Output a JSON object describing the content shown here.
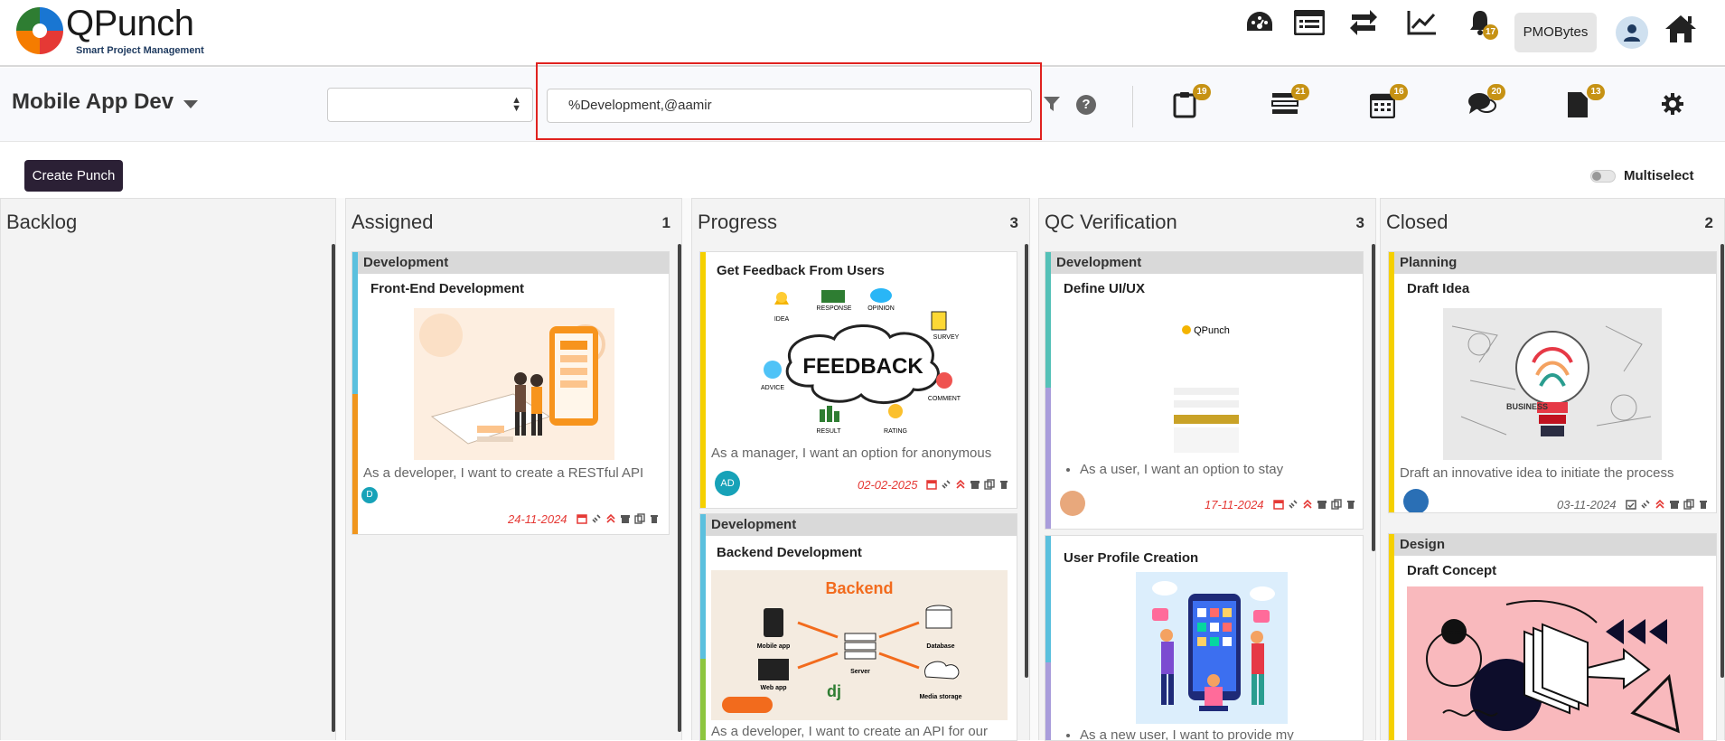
{
  "nav": {
    "brand": "QPunch",
    "tagline": "Smart Project Management",
    "notification_count": "17",
    "user_org": "PMOBytes",
    "icons": [
      "dashboard-icon",
      "list-icon",
      "sync-icon",
      "chart-line-icon",
      "bell-icon",
      "profile-avatar-icon",
      "home-icon"
    ]
  },
  "project": {
    "title": "Mobile App Dev",
    "select_value": "",
    "search_value": "%Development,@aamir",
    "tools": [
      {
        "icon": "clipboard-icon",
        "count": "19"
      },
      {
        "icon": "tasks-icon",
        "count": "21"
      },
      {
        "icon": "calendar-icon",
        "count": "16"
      },
      {
        "icon": "comments-icon",
        "count": "20"
      },
      {
        "icon": "file-icon",
        "count": "13"
      }
    ]
  },
  "actions": {
    "create_label": "Create Punch",
    "multiselect_label": "Multiselect"
  },
  "columns": [
    {
      "title": "Backlog",
      "count": ""
    },
    {
      "title": "Assigned",
      "count": "1"
    },
    {
      "title": "Progress",
      "count": "3"
    },
    {
      "title": "QC Verification",
      "count": "3"
    },
    {
      "title": "Closed",
      "count": "2"
    }
  ],
  "cards": {
    "assigned_1": {
      "group": "Development",
      "title": "Front-End Development",
      "desc": "As a developer, I want to create a RESTful API",
      "avatar": "D",
      "date": "24-11-2024"
    },
    "progress_1": {
      "group": "",
      "title": "Get Feedback From Users",
      "desc": "As a manager, I want an option for anonymous",
      "avatar": "AD",
      "date": "02-02-2025",
      "img_text": {
        "center": "FEEDBACK",
        "idea": "IDEA",
        "response": "RESPONSE",
        "opinion": "OPINION",
        "survey": "SURVEY",
        "advice": "ADVICE",
        "comment": "COMMENT",
        "result": "RESULT",
        "rating": "RATING"
      }
    },
    "progress_2": {
      "group": "Development",
      "title": "Backend Development",
      "desc": "As a developer, I want to create an API for our",
      "img_text": {
        "heading": "Backend",
        "mobile": "Mobile app",
        "web": "Web app",
        "server": "Server",
        "database": "Database",
        "media": "Media storage",
        "dj": "dj"
      }
    },
    "qc_1": {
      "group": "Development",
      "title": "Define UI/UX",
      "desc": "As a user, I want an option to stay",
      "date": "17-11-2024",
      "img_text": {
        "brand": "QPunch"
      }
    },
    "qc_2": {
      "group": "",
      "title": "User Profile Creation",
      "desc": "As a new user, I want to provide my"
    },
    "closed_1": {
      "group": "Planning",
      "title": "Draft Idea",
      "desc": "Draft an innovative idea to initiate the process",
      "date": "03-11-2024",
      "img_text": {
        "business": "BUSINESS"
      }
    },
    "closed_2": {
      "group": "Design",
      "title": "Draft Concept"
    }
  },
  "colors": {
    "accent_badge": "#c69214",
    "create_button": "#2b2035",
    "due_date": "#e53935",
    "highlight_box": "#e0221f"
  }
}
